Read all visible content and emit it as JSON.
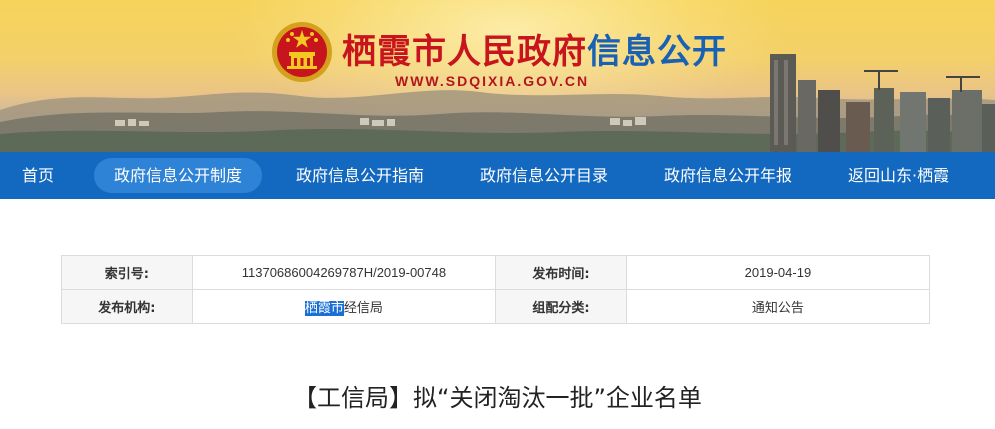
{
  "header": {
    "title_red": "栖霞市人民政府",
    "title_blue": "信息公开",
    "url": "WWW.SDQIXIA.GOV.CN",
    "emblem_icon": "national-emblem-icon",
    "colors": {
      "title_red": "#c8151d",
      "title_blue": "#1961b5",
      "nav_bg": "#1368bf"
    }
  },
  "nav": {
    "items": [
      {
        "label": "首页"
      },
      {
        "label": "政府信息公开制度",
        "active": true
      },
      {
        "label": "政府信息公开指南"
      },
      {
        "label": "政府信息公开目录"
      },
      {
        "label": "政府信息公开年报"
      },
      {
        "label": "返回山东·栖霞"
      }
    ]
  },
  "info": {
    "index_label": "索引号:",
    "index_value": "11370686004269787H/2019-00748",
    "date_label": "发布时间:",
    "date_value": "2019-04-19",
    "publisher_label": "发布机构:",
    "publisher_highlight": "栖霞市",
    "publisher_rest": "经信局",
    "category_label": "组配分类:",
    "category_value": "通知公告"
  },
  "article": {
    "title": "【工信局】拟“关闭淘汰一批”企业名单"
  }
}
